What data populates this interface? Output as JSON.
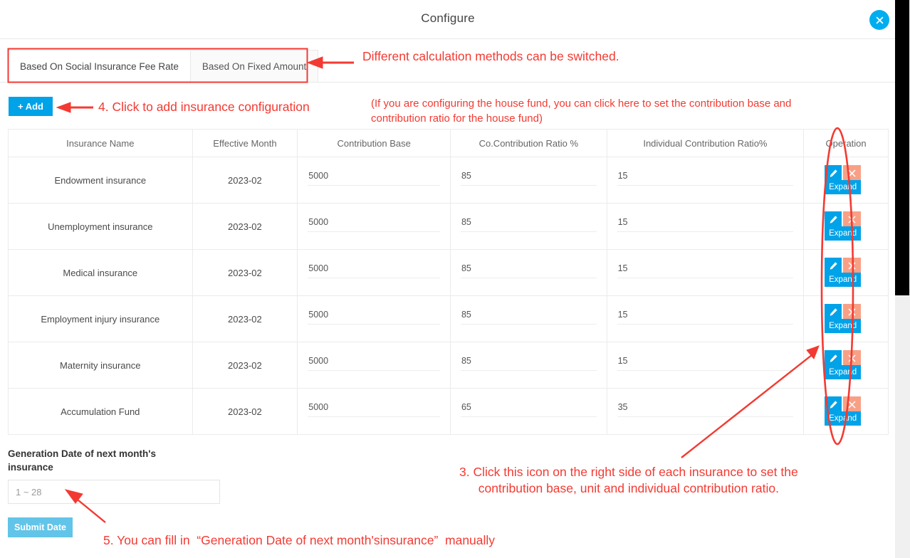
{
  "dialog": {
    "title": "Configure",
    "close_icon": "close-icon"
  },
  "tabs": [
    {
      "label": "Based On Social Insurance Fee Rate",
      "active": true
    },
    {
      "label": "Based On Fixed Amount",
      "active": false
    }
  ],
  "toolbar": {
    "add_label": "+ Add"
  },
  "table": {
    "columns": [
      "Insurance Name",
      "Effective Month",
      "Contribution Base",
      "Co.Contribution Ratio %",
      "Individual Contribution Ratio%",
      "Operation"
    ],
    "row_ops": {
      "edit_icon": "pencil-icon",
      "delete_icon": "close-icon",
      "expand_label": "Expand"
    },
    "rows": [
      {
        "name": "Endowment insurance",
        "month": "2023-02",
        "base": "5000",
        "co_ratio": "85",
        "ind_ratio": "15"
      },
      {
        "name": "Unemployment insurance",
        "month": "2023-02",
        "base": "5000",
        "co_ratio": "85",
        "ind_ratio": "15"
      },
      {
        "name": "Medical insurance",
        "month": "2023-02",
        "base": "5000",
        "co_ratio": "85",
        "ind_ratio": "15"
      },
      {
        "name": "Employment injury insurance",
        "month": "2023-02",
        "base": "5000",
        "co_ratio": "85",
        "ind_ratio": "15"
      },
      {
        "name": "Maternity insurance",
        "month": "2023-02",
        "base": "5000",
        "co_ratio": "85",
        "ind_ratio": "15"
      },
      {
        "name": "Accumulation Fund",
        "month": "2023-02",
        "base": "5000",
        "co_ratio": "65",
        "ind_ratio": "35"
      }
    ]
  },
  "form": {
    "label": "Generation Date of next month's insurance",
    "date_placeholder": "1 ~ 28",
    "date_value": "",
    "submit_label": "Submit Date"
  },
  "annotations": {
    "switch_methods": "Different calculation methods can be switched.",
    "add_config": "4. Click to add insurance configuration",
    "house_fund": "(If you are configuring the house fund, you can click here to set the contribution base and\ncontribution ratio for the house fund)",
    "click_icon": "3. Click this icon on the right side of each insurance to set the\ncontribution base, unit and individual contribution ratio.",
    "manual_fill": "5. You can fill in  “Generation Date of next month'sinsurance”  manually"
  },
  "colors": {
    "accent_blue": "#00a2e8",
    "close_blue": "#00aeef",
    "delete_salmon": "#f8a086",
    "submit_blue": "#62c4e8",
    "annotation_red": "#f33a32"
  }
}
